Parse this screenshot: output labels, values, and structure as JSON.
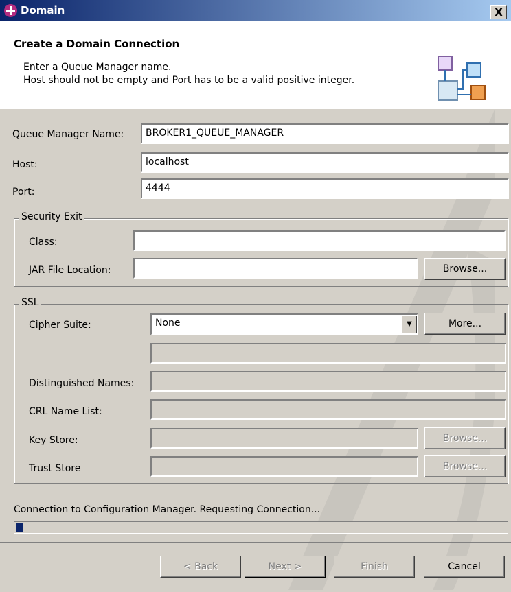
{
  "window": {
    "title": "Domain",
    "close_label": "X"
  },
  "banner": {
    "title": "Create a Domain Connection",
    "desc_line1": "Enter a Queue Manager name.",
    "desc_line2": "Host should not be empty and Port has to be a valid positive integer.",
    "icon": "domain-network-icon"
  },
  "form": {
    "qm_label": "Queue Manager Name:",
    "qm_value": "BROKER1_QUEUE_MANAGER",
    "host_label": "Host:",
    "host_value": "localhost",
    "port_label": "Port:",
    "port_value": "4444"
  },
  "security": {
    "group_label": "Security Exit",
    "class_label": "Class:",
    "class_value": "",
    "jar_label": "JAR File Location:",
    "jar_value": "",
    "browse_label": "Browse..."
  },
  "ssl": {
    "group_label": "SSL",
    "cipher_label": "Cipher Suite:",
    "cipher_value": "None",
    "more_label": "More...",
    "dn_label": "Distinguished Names:",
    "crl_label": "CRL Name List:",
    "keystore_label": "Key Store:",
    "truststore_label": "Trust Store",
    "browse_label": "Browse..."
  },
  "status": {
    "text": "Connection to Configuration Manager. Requesting Connection...",
    "progress": 0.015
  },
  "buttons": {
    "back": "< Back",
    "next": "Next >",
    "finish": "Finish",
    "cancel": "Cancel"
  },
  "colors": {
    "title_bar_start": "#0a246a",
    "title_bar_end": "#a6caf0",
    "dialog_bg": "#d4d0c8",
    "app_icon": "#b32c7f"
  }
}
